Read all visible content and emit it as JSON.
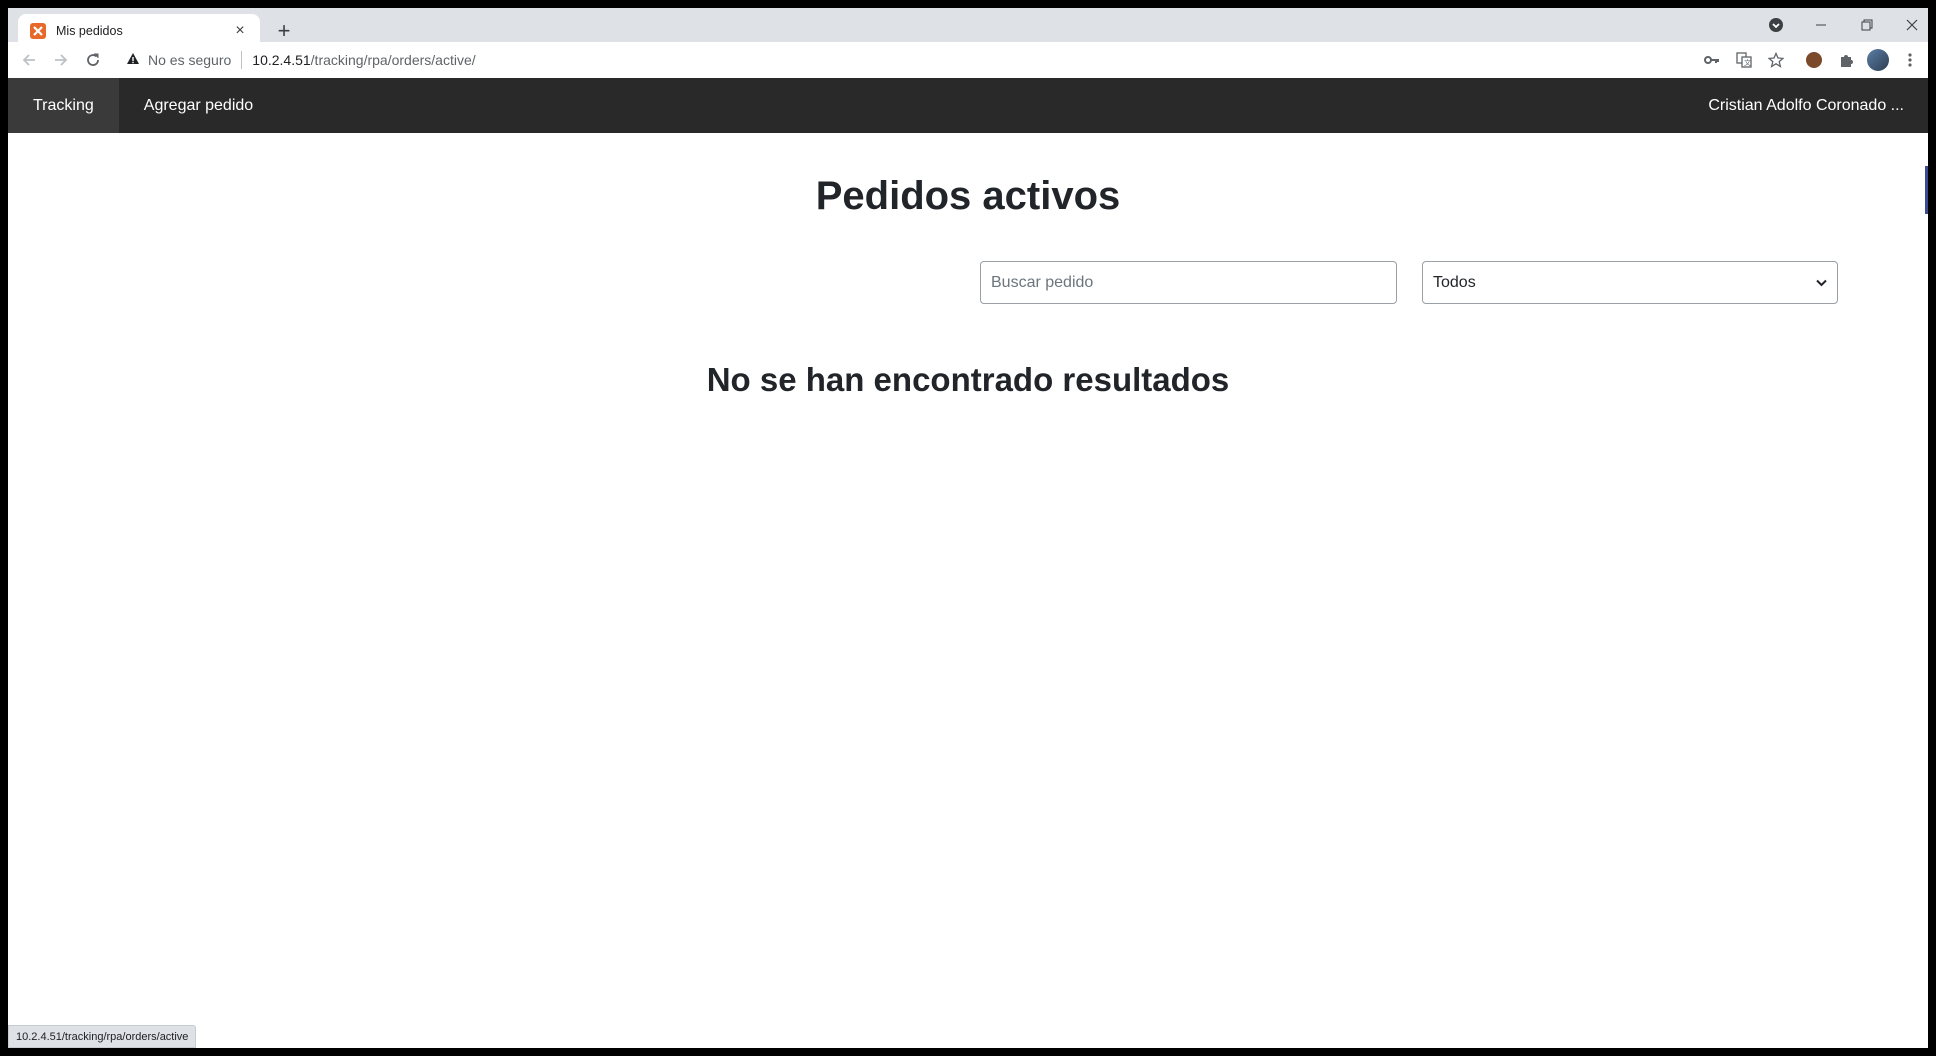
{
  "browser": {
    "tab_title": "Mis pedidos",
    "tab_close": "×",
    "new_tab": "+",
    "security_label": "No es seguro",
    "url_host": "10.2.4.51",
    "url_path": "/tracking/rpa/orders/active/",
    "status_url": "10.2.4.51/tracking/rpa/orders/active"
  },
  "navbar": {
    "items": [
      {
        "label": "Tracking",
        "active": true
      },
      {
        "label": "Agregar pedido",
        "active": false
      }
    ],
    "user": "Cristian Adolfo Coronado ..."
  },
  "main": {
    "title": "Pedidos activos",
    "search_placeholder": "Buscar pedido",
    "filter_value": "Todos",
    "empty_message": "No se han encontrado resultados"
  }
}
